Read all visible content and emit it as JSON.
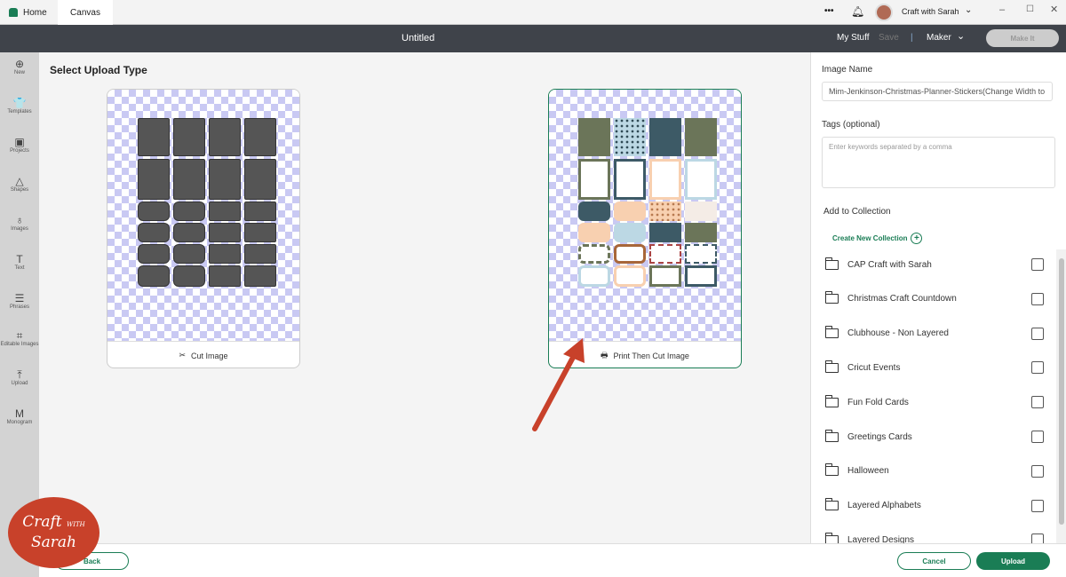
{
  "topbar": {
    "home": "Home",
    "canvas": "Canvas",
    "more": "•••",
    "account": "Craft with Sarah"
  },
  "header": {
    "title": "Untitled",
    "my_stuff": "My Stuff",
    "save": "Save",
    "separator": "|",
    "machine": "Maker",
    "make_it": "Make It"
  },
  "page_title": "Select Upload Type",
  "sidebar": [
    {
      "label": "New",
      "icon": "⊕"
    },
    {
      "label": "Templates",
      "icon": "👕"
    },
    {
      "label": "Projects",
      "icon": "▣"
    },
    {
      "label": "Shapes",
      "icon": "△"
    },
    {
      "label": "Images",
      "icon": "♁"
    },
    {
      "label": "Text",
      "icon": "T"
    },
    {
      "label": "Phrases",
      "icon": "☰"
    },
    {
      "label": "Editable Images",
      "icon": "⌗"
    },
    {
      "label": "Upload",
      "icon": "⤒"
    },
    {
      "label": "Monogram",
      "icon": "M"
    }
  ],
  "cards": {
    "cut": "Cut Image",
    "print": "Print Then Cut Image"
  },
  "panel": {
    "image_name_label": "Image Name",
    "image_name_value": "Mim-Jenkinson-Christmas-Planner-Stickers(Change Width to",
    "tags_label": "Tags (optional)",
    "tags_placeholder": "Enter keywords separated by a comma",
    "collection_label": "Add to Collection",
    "create_collection": "Create New Collection",
    "collections": [
      "CAP Craft with Sarah",
      "Christmas Craft Countdown",
      "Clubhouse - Non Layered",
      "Cricut Events",
      "Fun Fold Cards",
      "Greetings Cards",
      "Halloween",
      "Layered Alphabets",
      "Layered Designs"
    ]
  },
  "footer": {
    "back": "Back",
    "cancel": "Cancel",
    "upload": "Upload"
  },
  "logo": {
    "text": "Craft with Sarah"
  },
  "colors": {
    "accent": "#1a7d55",
    "dark": "#3f434a",
    "arrow": "#c8412a",
    "shape": "#555555",
    "navy": "#3d5a66",
    "olive": "#6b7559",
    "peach": "#f8d0b0",
    "lightblue": "#bcd8e4",
    "brown": "#a8673a"
  }
}
